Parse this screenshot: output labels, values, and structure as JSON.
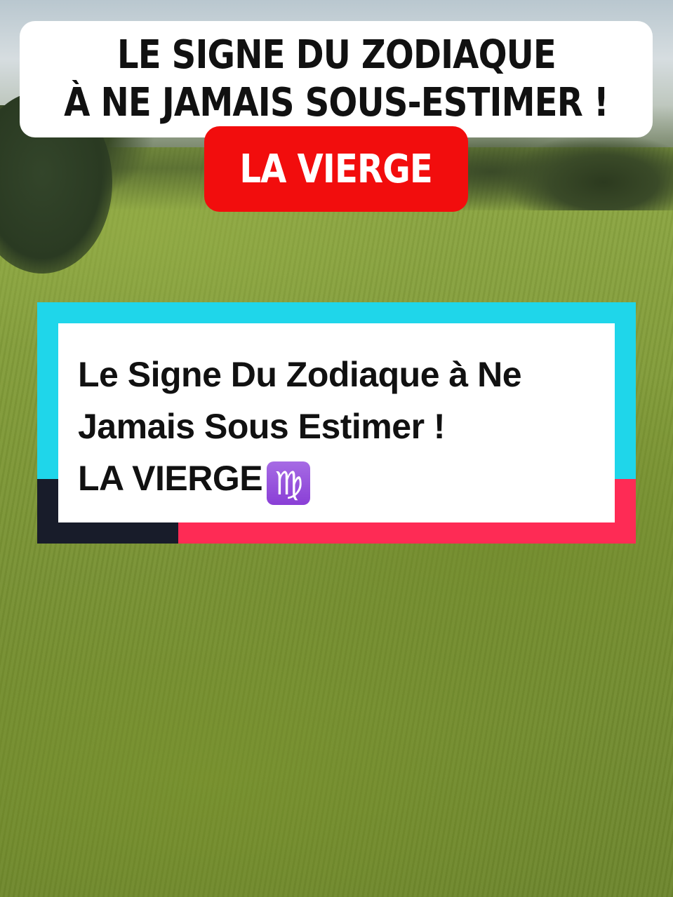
{
  "overlay": {
    "title_line_1": "LE SIGNE DU ZODIAQUE",
    "title_line_2": "À NE JAMAIS SOUS-ESTIMER !",
    "badge": "LA VIERGE"
  },
  "caption_card": {
    "line_1": "Le Signe Du Zodiaque à Ne",
    "line_2": "Jamais Sous Estimer !",
    "line_3": "LA VIERGE",
    "emoji_icon": "virgo-zodiac-icon",
    "emoji_glyph": "♍"
  },
  "colors": {
    "badge_red": "#f20d0d",
    "frame_cyan": "#1fd6ea",
    "frame_pink": "#fe2b55",
    "frame_dark": "#181c2a",
    "virgo_purple": "#8a3fd6"
  }
}
